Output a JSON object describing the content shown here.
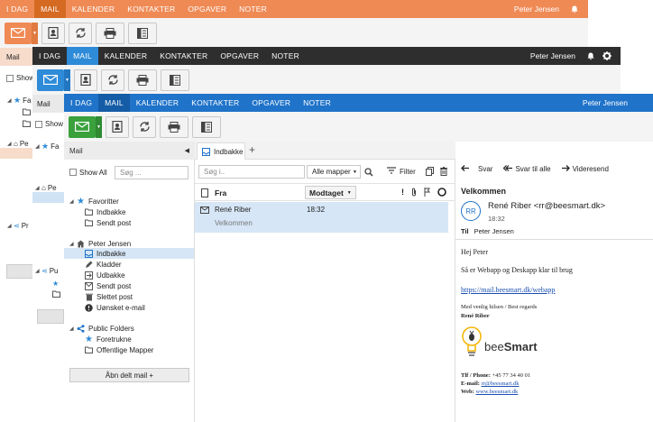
{
  "nav": {
    "items": [
      "I DAG",
      "MAIL",
      "KALENDER",
      "KONTAKTER",
      "OPGAVER",
      "NOTER"
    ],
    "user": "Peter Jensen"
  },
  "themes": {
    "orange": {
      "bar": "#ef8a55",
      "active": "#d56a22",
      "toolbar": "#f4f4f4",
      "mail": "#ef8a55"
    },
    "dark": {
      "bar": "#2e2e2e",
      "active": "#2e8bd8",
      "toolbar": "#f4f4f4",
      "mail": "#2e8bd8"
    },
    "blue": {
      "bar": "#1f73c9",
      "active": "#155ca6",
      "toolbar": "#f4f4f4",
      "mail": "#3aa13d"
    }
  },
  "back_layers": {
    "mail_label": "Mail",
    "show_all_short": "Show",
    "fav_short": "Fa",
    "pe_short": "Pe",
    "pu_short": "Pu",
    "pr_short": "Pr"
  },
  "left_panel": {
    "title": "Mail",
    "show_all": "Show All",
    "search_placeholder": "Søg ...",
    "favorites": {
      "label": "Favoritter",
      "items": [
        "Indbakke",
        "Sendt post"
      ]
    },
    "account": {
      "label": "Peter Jensen",
      "items": [
        "Indbakke",
        "Kladder",
        "Udbakke",
        "Sendt post",
        "Slettet post",
        "Uønsket e-mail"
      ]
    },
    "public": {
      "label": "Public Folders",
      "items": [
        "Foretrukne",
        "Offentlige Mapper"
      ]
    },
    "open_shared": "Åbn delt mail +"
  },
  "tabs": {
    "active": "Indbakke",
    "add": "+"
  },
  "list": {
    "search_placeholder": "Søg i..",
    "folder_select": "Alle mapper",
    "filter": "Filter",
    "col_from": "Fra",
    "col_received": "Modtaget",
    "rows": [
      {
        "from": "René Riber",
        "time": "18:32",
        "subject": "Velkommen"
      }
    ]
  },
  "reading": {
    "actions": {
      "reply": "Svar",
      "reply_all": "Svar til alle",
      "forward": "Videresend"
    },
    "subject": "Velkommen",
    "avatar": "RR",
    "sender": "René Riber <rr@beesmart.dk>",
    "time": "18:32",
    "to_label": "Til",
    "to": "Peter Jensen",
    "body": {
      "greeting": "Hej Peter",
      "line1": "Så er Webapp og Deskapp klar til brug",
      "link": "https://mail.beesmart.dk/webapp",
      "signoff": "Med venlig hilsen / Best regards",
      "name": "René Riber",
      "brand_bee": "bee",
      "brand_smart": "Smart",
      "phone_label": "Tlf / Phone:",
      "phone": "+45 77 34 40 01",
      "email_label": "E-mail:",
      "email": "rr@beesmart.dk",
      "web_label": "Web:",
      "web": "www.beesmart.dk"
    }
  }
}
